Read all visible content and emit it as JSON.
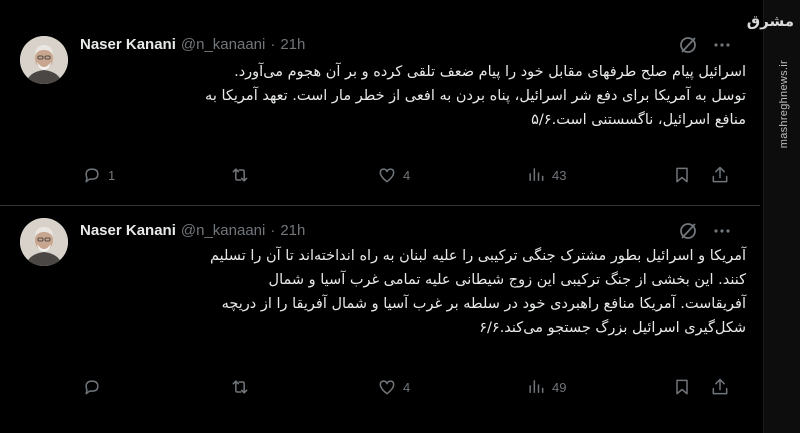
{
  "tweets": [
    {
      "author_name": "Naser Kanani",
      "author_handle": "@n_kanaani",
      "separator": "·",
      "time": "21h",
      "lines": [
        "اسرائیل پیام صلح طرفهای مقابل خود را پیام ضعف تلقی کرده و بر آن هجوم می‌آورد.",
        "توسل به آمریکا برای دفع شر اسرائیل، پناه بردن به افعی از خطر مار است. تعهد آمریکا به",
        "منافع اسرائیل، ناگسستنی است.۵/۶"
      ],
      "replies": "1",
      "retweets": "",
      "likes": "4",
      "views": "43"
    },
    {
      "author_name": "Naser Kanani",
      "author_handle": "@n_kanaani",
      "separator": "·",
      "time": "21h",
      "lines": [
        "آمریکا و اسرائیل بطور مشترک جنگی ترکیبی را علیه لبنان به راه انداخته‌اند تا آن را تسلیم",
        "کنند. این بخشی از جنگ ترکیبی این زوج شیطانی علیه تمامی غرب آسیا و شمال",
        "آفریقاست. آمریکا منافع راهبردی خود در سلطه بر غرب آسیا و شمال آفریقا را از دریچه",
        "شکل‌گیری اسرائیل بزرگ جستجو می‌کند.۶/۶"
      ],
      "replies": "",
      "retweets": "",
      "likes": "4",
      "views": "49"
    }
  ],
  "watermark": {
    "logo_text": "مشرق",
    "url": "mashreghnews.ir"
  },
  "icons": {
    "reply": "reply-icon",
    "retweet": "retweet-icon",
    "like": "heart-icon",
    "views": "views-icon",
    "bookmark": "bookmark-icon",
    "share": "share-icon",
    "grok": "grok-icon",
    "more": "more-icon"
  },
  "colors": {
    "background": "#000000",
    "text": "#e7e9ea",
    "muted": "#71767b",
    "divider": "#2f3336"
  }
}
